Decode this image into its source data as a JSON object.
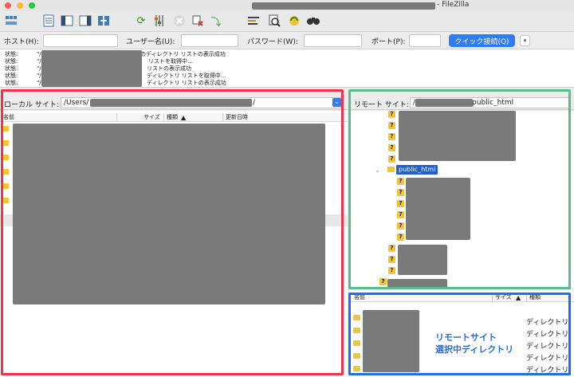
{
  "window": {
    "title_suffix": "- FileZilla",
    "colors": {
      "close": "#fc5f57",
      "minimize": "#fdbc2e",
      "zoom": "#28c840"
    }
  },
  "toolbar": {
    "icons": [
      "site-manager-icon",
      "toggle-log-icon",
      "toggle-local-tree-icon",
      "toggle-remote-tree-icon",
      "transfer-queue-icon",
      "refresh-icon",
      "process-queue-icon",
      "cancel-icon",
      "disconnect-icon",
      "reconnect-icon",
      "filter-icon",
      "compare-icon",
      "sync-browse-icon",
      "search-icon"
    ]
  },
  "quickconnect": {
    "host_label": "ホスト(H):",
    "user_label": "ユーザー名(U):",
    "password_label": "パスワード(W):",
    "port_label": "ポート(P):",
    "button_label": "クイック接続(Q)",
    "dropdown_glyph": "▾"
  },
  "log": {
    "rows": [
      {
        "kind": "状態:",
        "prefix": "\"/",
        "message": "のディレクトリ リストの表示成功"
      },
      {
        "kind": "状態:",
        "prefix": "\"/",
        "message": "リストを取得中..."
      },
      {
        "kind": "状態:",
        "prefix": "\"/",
        "message": "リストの表示成功"
      },
      {
        "kind": "状態:",
        "prefix": "\"/",
        "message": "ディレクトリ リストを取得中..."
      },
      {
        "kind": "状態:",
        "prefix": "\"/",
        "message": "ディレクトリ リストの表示成功"
      }
    ]
  },
  "local": {
    "site_label": "ローカル サイト:",
    "path_prefix": "/Users/",
    "path_suffix": "/",
    "columns": {
      "name": "名前",
      "size": "サイズ",
      "type": "種類",
      "modified": "更新日時"
    },
    "sort_glyph": "▲",
    "dropdown_glyph": "⌄"
  },
  "remote": {
    "site_label": "リモート サイト:",
    "path_prefix": "/",
    "path_suffix": "/public_html",
    "tree_selected": "public_html",
    "tree_unknown_glyph": "?",
    "tree_expand_glyph": "⌄",
    "columns": {
      "name": "名前",
      "size": "サイズ",
      "type": "種類"
    },
    "sort_glyph": "▲",
    "file_types": [
      "ディレクトリ",
      "ディレクトリ",
      "ディレクトリ",
      "ディレクトリ",
      "ディレクトリ"
    ]
  },
  "annotation": {
    "line1": "リモートサイト",
    "line2": "選択中ディレクトリ",
    "colors": {
      "local": "#f0324a",
      "remote_tree": "#5bbd8f",
      "remote_list": "#1f6fe5",
      "text": "#1f6fe5"
    }
  }
}
